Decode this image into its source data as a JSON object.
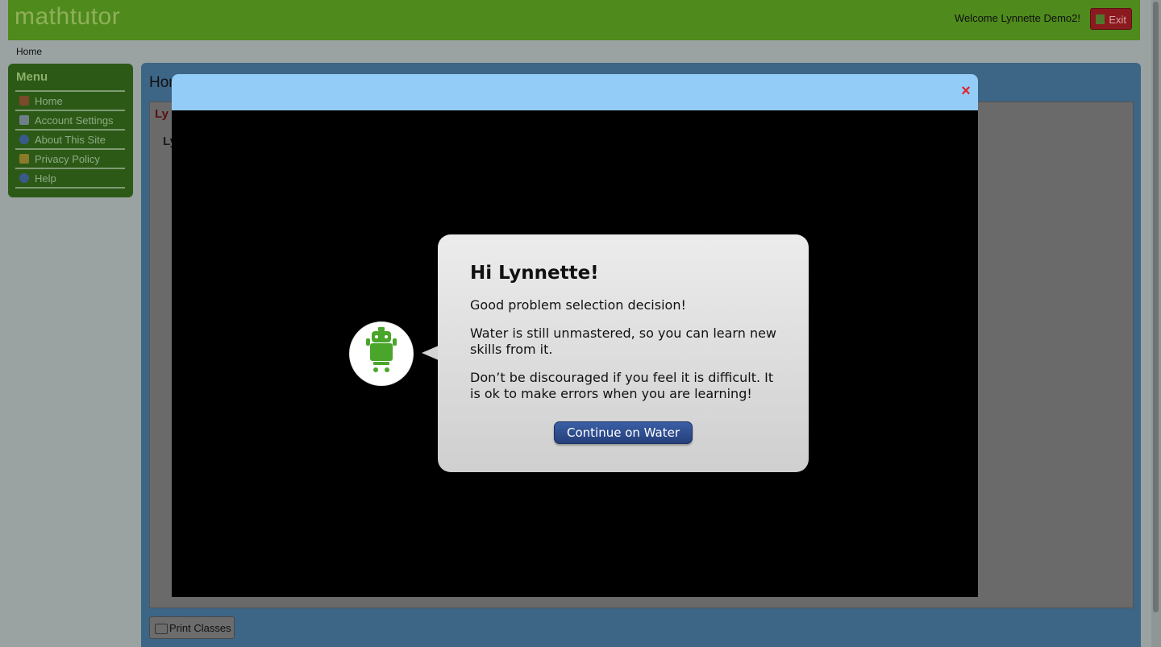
{
  "header": {
    "logo": "mathtutor",
    "welcome": "Welcome Lynnette Demo2!",
    "exit_label": "Exit"
  },
  "breadcrumb": "Home",
  "menu": {
    "title": "Menu",
    "items": [
      {
        "label": "Home",
        "icon": "house-icon"
      },
      {
        "label": "Account Settings",
        "icon": "id-card-icon"
      },
      {
        "label": "About This Site",
        "icon": "info-icon"
      },
      {
        "label": "Privacy Policy",
        "icon": "shield-icon"
      },
      {
        "label": "Help",
        "icon": "help-icon"
      }
    ]
  },
  "content": {
    "title": "Hom",
    "line1": "Ly",
    "line2": "Ly",
    "print_label": "Print Classes"
  },
  "modal": {
    "close_icon": "×",
    "dialog": {
      "title": "Hi Lynnette!",
      "paragraphs": [
        "Good problem selection decision!",
        "Water is still unmastered, so you can learn new skills from it.",
        "Don’t be discouraged if you feel it is difficult. It is ok to make errors when you are learning!"
      ],
      "button": "Continue on Water"
    }
  },
  "colors": {
    "header_green": "#4f8a1c",
    "modal_header": "#94ccf8",
    "button_blue": "#2e4f91",
    "robot_green": "#4aa52b",
    "close_red": "#e0242c"
  }
}
